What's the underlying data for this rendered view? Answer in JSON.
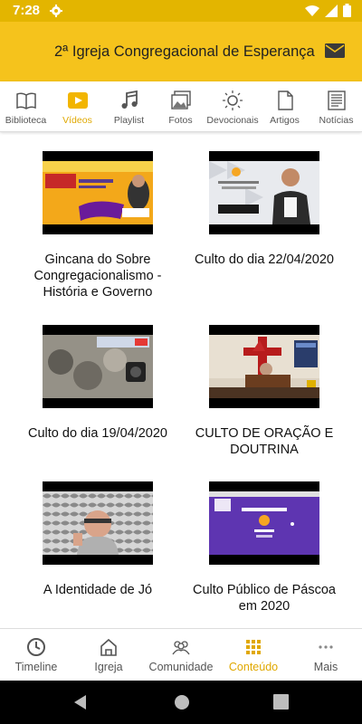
{
  "status_bar": {
    "time": "7:28"
  },
  "app_bar": {
    "title": "2ª Igreja Congregacional de Esperança"
  },
  "tabs": [
    {
      "label": "Biblioteca",
      "icon": "book-icon"
    },
    {
      "label": "Vídeos",
      "icon": "video-play-icon",
      "active": true
    },
    {
      "label": "Playlist",
      "icon": "music-note-icon"
    },
    {
      "label": "Fotos",
      "icon": "photos-icon"
    },
    {
      "label": "Devocionais",
      "icon": "sun-icon"
    },
    {
      "label": "Artigos",
      "icon": "document-icon"
    },
    {
      "label": "Notícias",
      "icon": "newspaper-icon"
    }
  ],
  "videos": [
    {
      "title": "Gincana do Sobre Congregacionalismo - História e Governo"
    },
    {
      "title": "Culto do dia 22/04/2020"
    },
    {
      "title": "Culto do dia 19/04/2020"
    },
    {
      "title": "CULTO DE ORAÇÃO E DOUTRINA"
    },
    {
      "title": "A Identidade de Jó"
    },
    {
      "title": "Culto Público de Páscoa em 2020"
    }
  ],
  "bottom_nav": [
    {
      "label": "Timeline",
      "icon": "clock-icon"
    },
    {
      "label": "Igreja",
      "icon": "home-icon"
    },
    {
      "label": "Comunidade",
      "icon": "people-icon"
    },
    {
      "label": "Conteúdo",
      "icon": "grid-icon",
      "active": true
    },
    {
      "label": "Mais",
      "icon": "more-dots-icon"
    }
  ],
  "colors": {
    "primary": "#f5c31c",
    "status": "#e3b500",
    "accent": "#e0a800"
  }
}
